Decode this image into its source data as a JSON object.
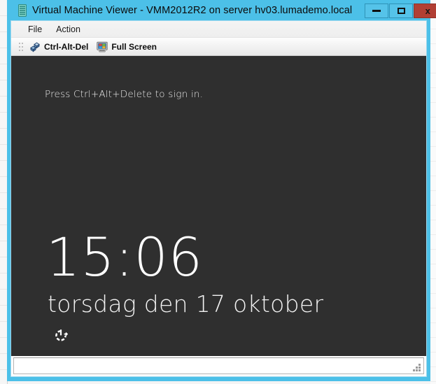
{
  "window": {
    "title": "Virtual Machine Viewer - VMM2012R2 on server hv03.lumademo.local",
    "icon": "server-rack-icon",
    "frame_color": "#4cc0e8",
    "controls": {
      "minimize_label": "",
      "maximize_label": "",
      "close_label": "x"
    }
  },
  "menu": {
    "items": [
      {
        "label": "File"
      },
      {
        "label": "Action"
      }
    ]
  },
  "toolbar": {
    "buttons": [
      {
        "label": "Ctrl-Alt-Del",
        "icon": "ctrl-alt-del-icon"
      },
      {
        "label": "Full Screen",
        "icon": "monitor-icon"
      }
    ]
  },
  "vm_screen": {
    "background_color": "#2f2f2f",
    "sign_in_hint": "Press Ctrl+Alt+Delete to sign in.",
    "clock": "15:06",
    "date": "torsdag den 17 oktober",
    "ease_of_access_icon": "ease-of-access-icon"
  },
  "status_bar": {
    "text": ""
  }
}
